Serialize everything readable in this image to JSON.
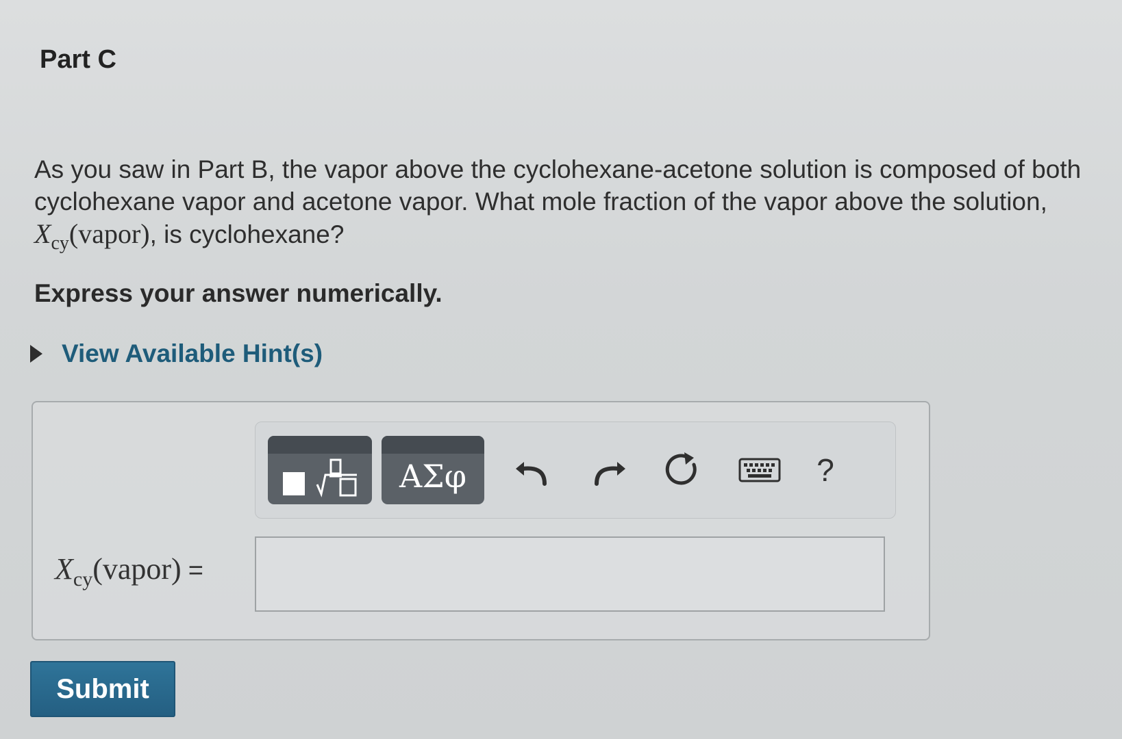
{
  "part": {
    "title": "Part C"
  },
  "question": {
    "text_before": "As you saw in Part B, the vapor above the cyclohexane-acetone solution is composed of both cyclohexane vapor and acetone vapor. What mole fraction of the vapor above the solution, ",
    "var_symbol": "X",
    "var_subscript": "cy",
    "var_arg": "(vapor)",
    "text_after": ", is cyclohexane?"
  },
  "instruction": "Express your answer numerically.",
  "hint": {
    "label": "View Available Hint(s)"
  },
  "toolbar": {
    "greek_label": "ΑΣφ",
    "help_label": "?",
    "icons": [
      "templates-icon",
      "undo-icon",
      "redo-icon",
      "reset-icon",
      "keyboard-icon",
      "help-icon"
    ]
  },
  "answer": {
    "var_symbol": "X",
    "var_subscript": "cy",
    "var_arg": "(vapor)",
    "equals": "=",
    "value": "",
    "placeholder": ""
  },
  "submit": {
    "label": "Submit"
  },
  "colors": {
    "link": "#1e5c7a",
    "submit": "#2a6a8e",
    "toolbar_button": "#5b6167"
  }
}
